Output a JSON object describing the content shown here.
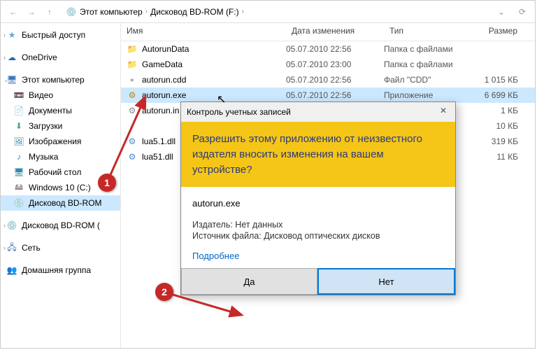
{
  "breadcrumb": {
    "root": "Этот компьютер",
    "drive": "Дисковод BD-ROM (F:)"
  },
  "sidebar": {
    "quick": "Быстрый доступ",
    "onedrive": "OneDrive",
    "thispc": "Этот компьютер",
    "video": "Видео",
    "documents": "Документы",
    "downloads": "Загрузки",
    "images": "Изображения",
    "music": "Музыка",
    "desktop": "Рабочий стол",
    "cdrive": "Windows 10 (C:)",
    "bdrom": "Дисковод BD-ROM",
    "bdrom2": "Дисковод BD-ROM (",
    "network": "Сеть",
    "homegroup": "Домашняя группа"
  },
  "columns": {
    "name": "Имя",
    "date": "Дата изменения",
    "type": "Тип",
    "size": "Размер"
  },
  "files": [
    {
      "name": "AutorunData",
      "date": "05.07.2010 22:56",
      "type": "Папка с файлами",
      "size": "",
      "icon": "folder"
    },
    {
      "name": "GameData",
      "date": "05.07.2010 23:00",
      "type": "Папка с файлами",
      "size": "",
      "icon": "folder"
    },
    {
      "name": "autorun.cdd",
      "date": "05.07.2010 22:56",
      "type": "Файл \"CDD\"",
      "size": "1 015 КБ",
      "icon": "file"
    },
    {
      "name": "autorun.exe",
      "date": "05.07.2010 22:56",
      "type": "Приложение",
      "size": "6 699 КБ",
      "icon": "exe",
      "selected": true
    },
    {
      "name": "autorun.in",
      "date": "",
      "type": "",
      "size": "1 КБ",
      "icon": "ini"
    },
    {
      "name": "",
      "date": "",
      "type": "",
      "size": "10 КБ",
      "icon": "blur"
    },
    {
      "name": "lua5.1.dll",
      "date": "",
      "type": "",
      "size": "319 КБ",
      "icon": "dll"
    },
    {
      "name": "lua51.dll",
      "date": "",
      "type": "",
      "size": "11 КБ",
      "icon": "dll"
    }
  ],
  "uac": {
    "title": "Контроль учетных записей",
    "question": "Разрешить этому приложению от неизвестного издателя вносить изменения на вашем устройстве?",
    "app": "autorun.exe",
    "publisher_label": "Издатель:",
    "publisher_value": "Нет данных",
    "source_label": "Источник файла:",
    "source_value": "Дисковод оптических дисков",
    "more": "Подробнее",
    "yes": "Да",
    "no": "Нет"
  },
  "callouts": {
    "one": "1",
    "two": "2"
  }
}
